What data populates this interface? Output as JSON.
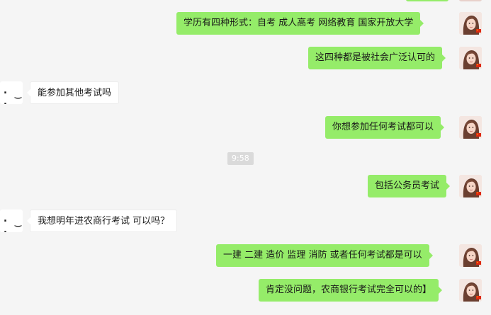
{
  "messages": {
    "m1": "学历有四种形式：自考  成人高考  网络教育  国家开放大学",
    "m2": "这四种都是被社会广泛认可的",
    "m3": "能参加其他考试吗",
    "m4": "你想参加任何考试都可以",
    "m5": "包括公务员考试",
    "m6": "我想明年进农商行考试  可以吗？",
    "m7": "一建  二建   造价  监理  消防   或者任何考试都是可以",
    "m8": "肯定没问题，农商银行考试完全可以的】"
  },
  "timestamp": "9:58",
  "contact_avatar": {
    "glyph": "· ‿ ·",
    "icon": "kaomoji-avatar-icon"
  },
  "my_avatar": {
    "icon": "girl-photo-avatar-icon",
    "flag_icon": "china-flag-icon"
  },
  "colors": {
    "chat_background": "#f5f5f5",
    "outgoing_bubble": "#95ec69",
    "incoming_bubble": "#ffffff",
    "timestamp_background": "#dadada"
  }
}
